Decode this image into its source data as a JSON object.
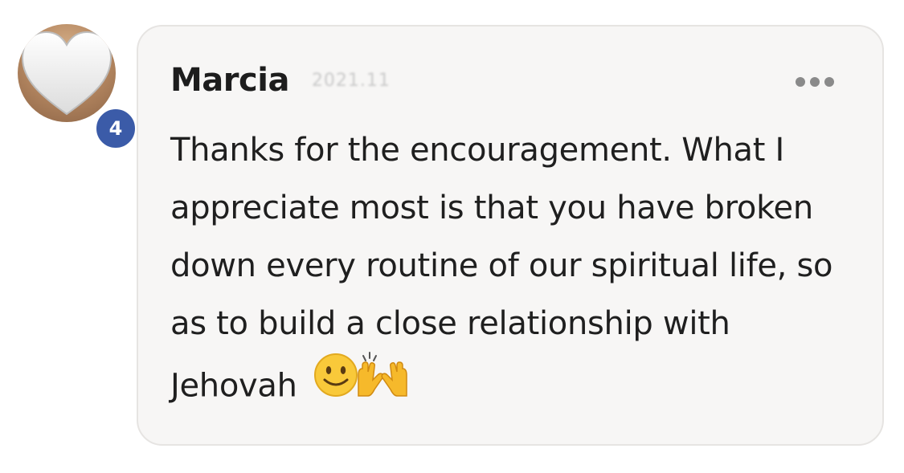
{
  "comment": {
    "author": "Marcia",
    "timestamp": "2021.11",
    "avatar_badge_count": "4",
    "text": "Thanks for the encouragement. What I appreciate most is that you have broken down every routine of our spiritual life, so as to build a close relationship with Jehovah",
    "emojis": [
      "slightly-smiling-face",
      "raising-hands"
    ],
    "more_icon": "more-horizontal-icon"
  },
  "colors": {
    "bubble_bg": "#f7f6f5",
    "badge_bg": "#3b5ba8",
    "text": "#1f1f1f"
  }
}
